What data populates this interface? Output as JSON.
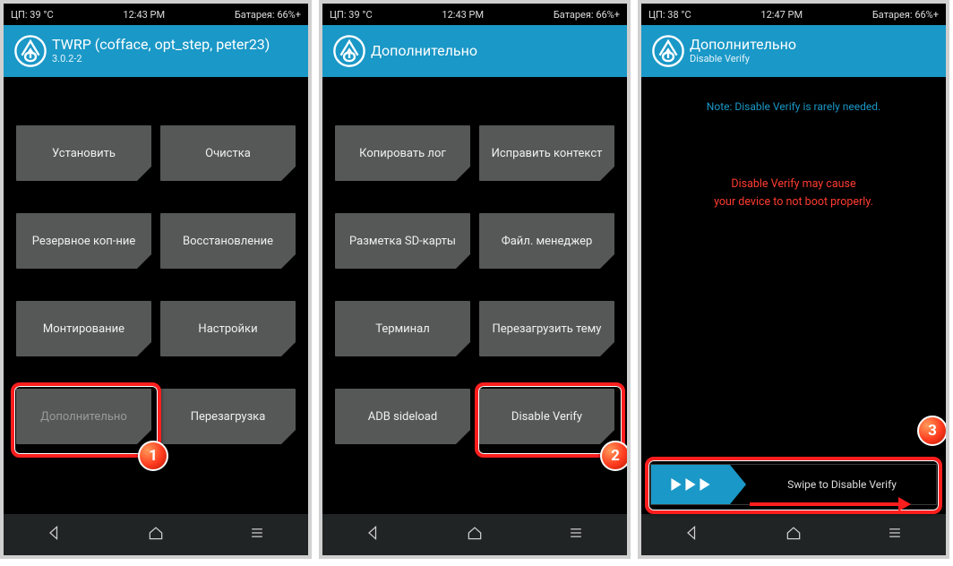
{
  "screen1": {
    "status": {
      "cpu": "ЦП: 39 °C",
      "time": "12:43 PM",
      "batt": "Батарея: 66%+"
    },
    "title": "TWRP (cofface, opt_step, peter23)",
    "subtitle": "3.0.2-2",
    "buttons": [
      "Установить",
      "Очистка",
      "Резервное коп-ние",
      "Восстановление",
      "Монтирование",
      "Настройки",
      "Дополнительно",
      "Перезагрузка"
    ],
    "badge": "1"
  },
  "screen2": {
    "status": {
      "cpu": "ЦП: 39 °C",
      "time": "12:43 PM",
      "batt": "Батарея: 66%+"
    },
    "title": "Дополнительно",
    "buttons": [
      "Копировать лог",
      "Исправить контекст",
      "Разметка SD-карты",
      "Файл. менеджер",
      "Терминал",
      "Перезагрузить тему",
      "ADB sideload",
      "Disable Verify"
    ],
    "badge": "2"
  },
  "screen3": {
    "status": {
      "cpu": "ЦП: 38 °C",
      "time": "12:47 PM",
      "batt": "Батарея: 66%+"
    },
    "title": "Дополнительно",
    "subtitle": "Disable Verify",
    "note": "Note: Disable Verify is rarely needed.",
    "warn1": "Disable Verify may cause",
    "warn2": "your device to not boot properly.",
    "slider": "Swipe to Disable Verify",
    "badge": "3"
  }
}
